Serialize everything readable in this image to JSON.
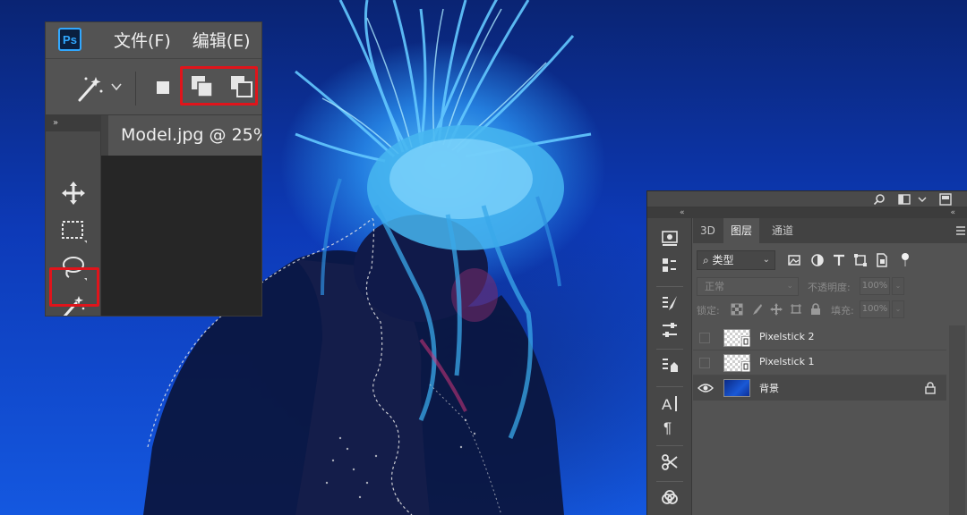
{
  "photoshop_window": {
    "logo_text": "Ps",
    "menu": [
      "文件(F)",
      "编辑(E)"
    ],
    "document_tab": "Model.jpg @ 25%",
    "toolstrip_collapse": "»",
    "icons": [
      "magic-wand-icon",
      "chevron-down-icon",
      "new-selection-icon",
      "add-to-selection-icon",
      "subtract-from-selection-icon",
      "move-tool-icon",
      "marquee-tool-icon",
      "lasso-tool-icon",
      "quick-selection-icon"
    ],
    "highlight_color": "#e0141b"
  },
  "layers_panel": {
    "collapse_left": "«",
    "collapse_right": "«",
    "tabs": [
      "3D",
      "图层",
      "通道"
    ],
    "active_tab": "图层",
    "filter_label": "类型",
    "blend_mode": "正常",
    "opacity_label": "不透明度:",
    "opacity_value": "100%",
    "lock_label": "锁定:",
    "fill_label": "填充:",
    "fill_value": "100%",
    "layers": [
      {
        "name": "Pixelstick 2",
        "visible": false,
        "type": "smart-object"
      },
      {
        "name": "Pixelstick 1",
        "visible": false,
        "type": "smart-object"
      },
      {
        "name": "背景",
        "visible": true,
        "type": "background",
        "locked": true
      }
    ]
  }
}
